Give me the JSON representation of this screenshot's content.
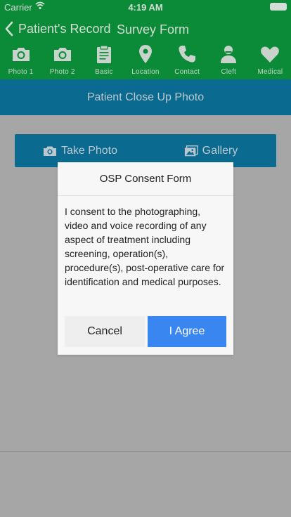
{
  "status_bar": {
    "carrier": "Carrier",
    "time": "4:19 AM"
  },
  "nav": {
    "back_label": "Patient's Record",
    "title": "Survey Form"
  },
  "tabs": [
    {
      "label": "Photo 1",
      "icon": "camera-icon"
    },
    {
      "label": "Photo 2",
      "icon": "camera-icon"
    },
    {
      "label": "Basic",
      "icon": "clipboard-icon"
    },
    {
      "label": "Location",
      "icon": "map-pin-icon"
    },
    {
      "label": "Contact",
      "icon": "phone-icon"
    },
    {
      "label": "Cleft",
      "icon": "person-icon"
    },
    {
      "label": "Medical",
      "icon": "heart-icon"
    }
  ],
  "section": {
    "title": "Patient Close Up Photo"
  },
  "photo_buttons": {
    "take_photo": "Take Photo",
    "gallery": "Gallery"
  },
  "modal": {
    "title": "OSP Consent Form",
    "body": "I consent to the photographing, video and voice recording of any aspect of treatment including screening, operation(s), procedure(s), post-operative care for identification and medical purposes.",
    "cancel_label": "Cancel",
    "agree_label": "I Agree"
  },
  "colors": {
    "header_green": "#0b8b38",
    "section_blue": "#0a6a8f",
    "agree_blue": "#3a86f1",
    "overlay_gray": "#a6a6a6"
  }
}
